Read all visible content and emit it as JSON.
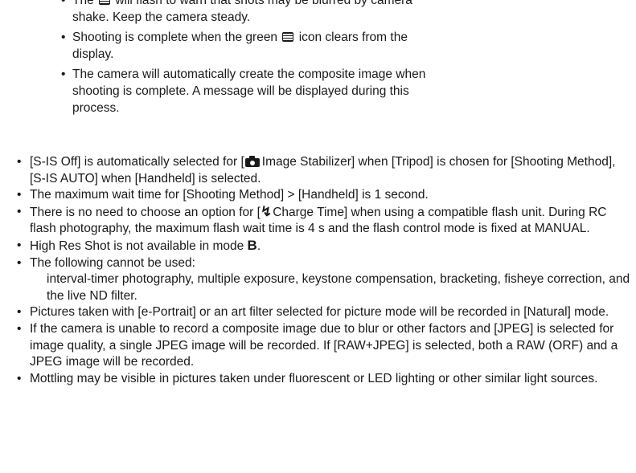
{
  "sub_bullets": [
    {
      "pre": "The",
      "icon": "high-res-shot-icon",
      "post": "will flash to warn that shots may be blurred by camera shake. Keep the camera steady."
    },
    {
      "pre": "Shooting is complete when the green",
      "icon": "high-res-shot-icon",
      "post": "icon clears from the display."
    },
    {
      "text": "The camera will automatically create the composite image when shooting is complete. A message will be displayed during this process."
    }
  ],
  "bullets": {
    "b1": {
      "pre": "[S-IS Off] is automatically selected for [",
      "icon": "camera-icon",
      "post": "Image Stabilizer] when [Tripod] is chosen for [Shooting Method], [S-IS AUTO] when [Handheld] is selected."
    },
    "b2": {
      "text": "The maximum wait time for [Shooting Method] > [Handheld] is 1 second."
    },
    "b3": {
      "pre": "There is no need to choose an option for [",
      "icon": "flash-icon",
      "icon_glyph": "↯",
      "post": "Charge Time] when using a compatible flash unit. During RC flash photography, the maximum flash wait time is 4 s and the flash control mode is fixed at MANUAL."
    },
    "b4": {
      "pre": "High Res Shot is not available in mode",
      "mode": "B",
      "post": "."
    },
    "b5": {
      "text": "The following cannot be used:",
      "sub": "interval-timer photography, multiple exposure, keystone compensation, bracketing, fisheye correction, and the live ND filter."
    },
    "b6": {
      "text": "Pictures taken with [e-Portrait] or an art filter selected for picture mode will be recorded in [Natural] mode."
    },
    "b7": {
      "text": "If the camera is unable to record a composite image due to blur or other factors and [JPEG] is selected for image quality, a single JPEG image will be recorded. If [RAW+JPEG] is selected, both a RAW (ORF) and a JPEG image will be recorded."
    },
    "b8": {
      "text": "Mottling may be visible in pictures taken under fluorescent or LED lighting or other similar light sources."
    }
  }
}
